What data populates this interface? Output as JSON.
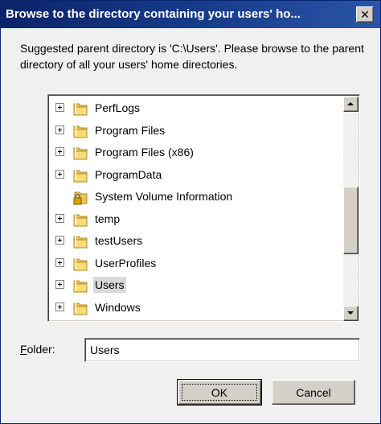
{
  "window": {
    "title": "Browse to the directory containing your users' ho...",
    "close_label": "✕"
  },
  "instruction": "Suggested parent directory is 'C:\\Users'. Please browse to the parent directory of all your users' home directories.",
  "tree": {
    "items": [
      {
        "label": "PerfLogs",
        "expandable": true,
        "icon": "folder-icon",
        "selected": false
      },
      {
        "label": "Program Files",
        "expandable": true,
        "icon": "folder-icon",
        "selected": false
      },
      {
        "label": "Program Files (x86)",
        "expandable": true,
        "icon": "folder-icon",
        "selected": false
      },
      {
        "label": "ProgramData",
        "expandable": true,
        "icon": "folder-icon",
        "selected": false
      },
      {
        "label": "System Volume Information",
        "expandable": false,
        "icon": "locked-folder-icon",
        "selected": false
      },
      {
        "label": "temp",
        "expandable": true,
        "icon": "folder-icon",
        "selected": false
      },
      {
        "label": "testUsers",
        "expandable": true,
        "icon": "folder-icon",
        "selected": false
      },
      {
        "label": "UserProfiles",
        "expandable": true,
        "icon": "folder-icon",
        "selected": false
      },
      {
        "label": "Users",
        "expandable": true,
        "icon": "folder-icon",
        "selected": true
      },
      {
        "label": "Windows",
        "expandable": true,
        "icon": "folder-icon",
        "selected": false
      }
    ]
  },
  "folder": {
    "label_accel": "F",
    "label_rest": "older:",
    "value": "Users"
  },
  "buttons": {
    "ok": "OK",
    "cancel": "Cancel"
  },
  "colors": {
    "titlebar": "#0a246a",
    "dialog_bg": "#f0f0f0",
    "selection": "#d9d9d9",
    "folder_yellow": "#f5d66b"
  }
}
